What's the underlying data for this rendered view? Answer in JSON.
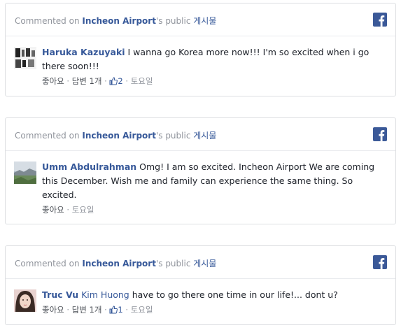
{
  "header_common": {
    "prefix": "Commented on ",
    "page": "Incheon Airport",
    "possessive": "'s public ",
    "post": "게시물"
  },
  "comments": [
    {
      "author": "Haruka Kazuyaki",
      "text": " I wanna go Korea more now!!! I'm so excited when i go there soon!!!",
      "like_label": "좋아요",
      "reply_label": "답변 1개",
      "like_count": "2",
      "date": "토요일",
      "avatar_icon": "profile-photo-icon"
    },
    {
      "author": "Umm Abdulrahman",
      "text": " Omg! I am so excited. Incheon Airport We are coming this December. Wish me and family can experience the same thing. So excited.",
      "like_label": "좋아요",
      "date": "토요일",
      "avatar_icon": "profile-photo-icon"
    },
    {
      "author": "Truc Vu",
      "mention": "Kim Huong",
      "text": " have to go there one time in our life!... dont u?",
      "like_label": "좋아요",
      "reply_label": "답변 1개",
      "like_count": "1",
      "date": "토요일",
      "avatar_icon": "profile-photo-icon"
    }
  ],
  "separator": " · ",
  "brand_icon": "facebook-icon",
  "colors": {
    "link": "#365899",
    "muted": "#90949c",
    "facebook": "#3b5998",
    "border": "#dddfe2"
  }
}
